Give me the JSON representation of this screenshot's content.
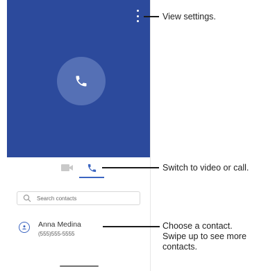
{
  "colors": {
    "hero_background": "#2c4a9c",
    "call_circle": "#5570b5",
    "accent": "#3b65c1",
    "inactive_icon": "#c9c9c9"
  },
  "phone": {
    "more_menu_icon": "more-vertical-icon",
    "call_icon": "phone-icon",
    "mode_tabs": [
      {
        "icon": "video-camera-icon",
        "selected": false
      },
      {
        "icon": "phone-icon",
        "selected": true
      }
    ],
    "search": {
      "placeholder": "Search contacts",
      "value": "",
      "icon": "search-icon"
    },
    "contact": {
      "name": "Anna Medina",
      "number": "(555)555-5555",
      "icon": "person-icon"
    }
  },
  "callouts": {
    "settings": "View settings.",
    "mode": "Switch to video or call.",
    "contact_line1": "Choose a contact.",
    "contact_line2": "Swipe up to see more",
    "contact_line3": "contacts."
  }
}
